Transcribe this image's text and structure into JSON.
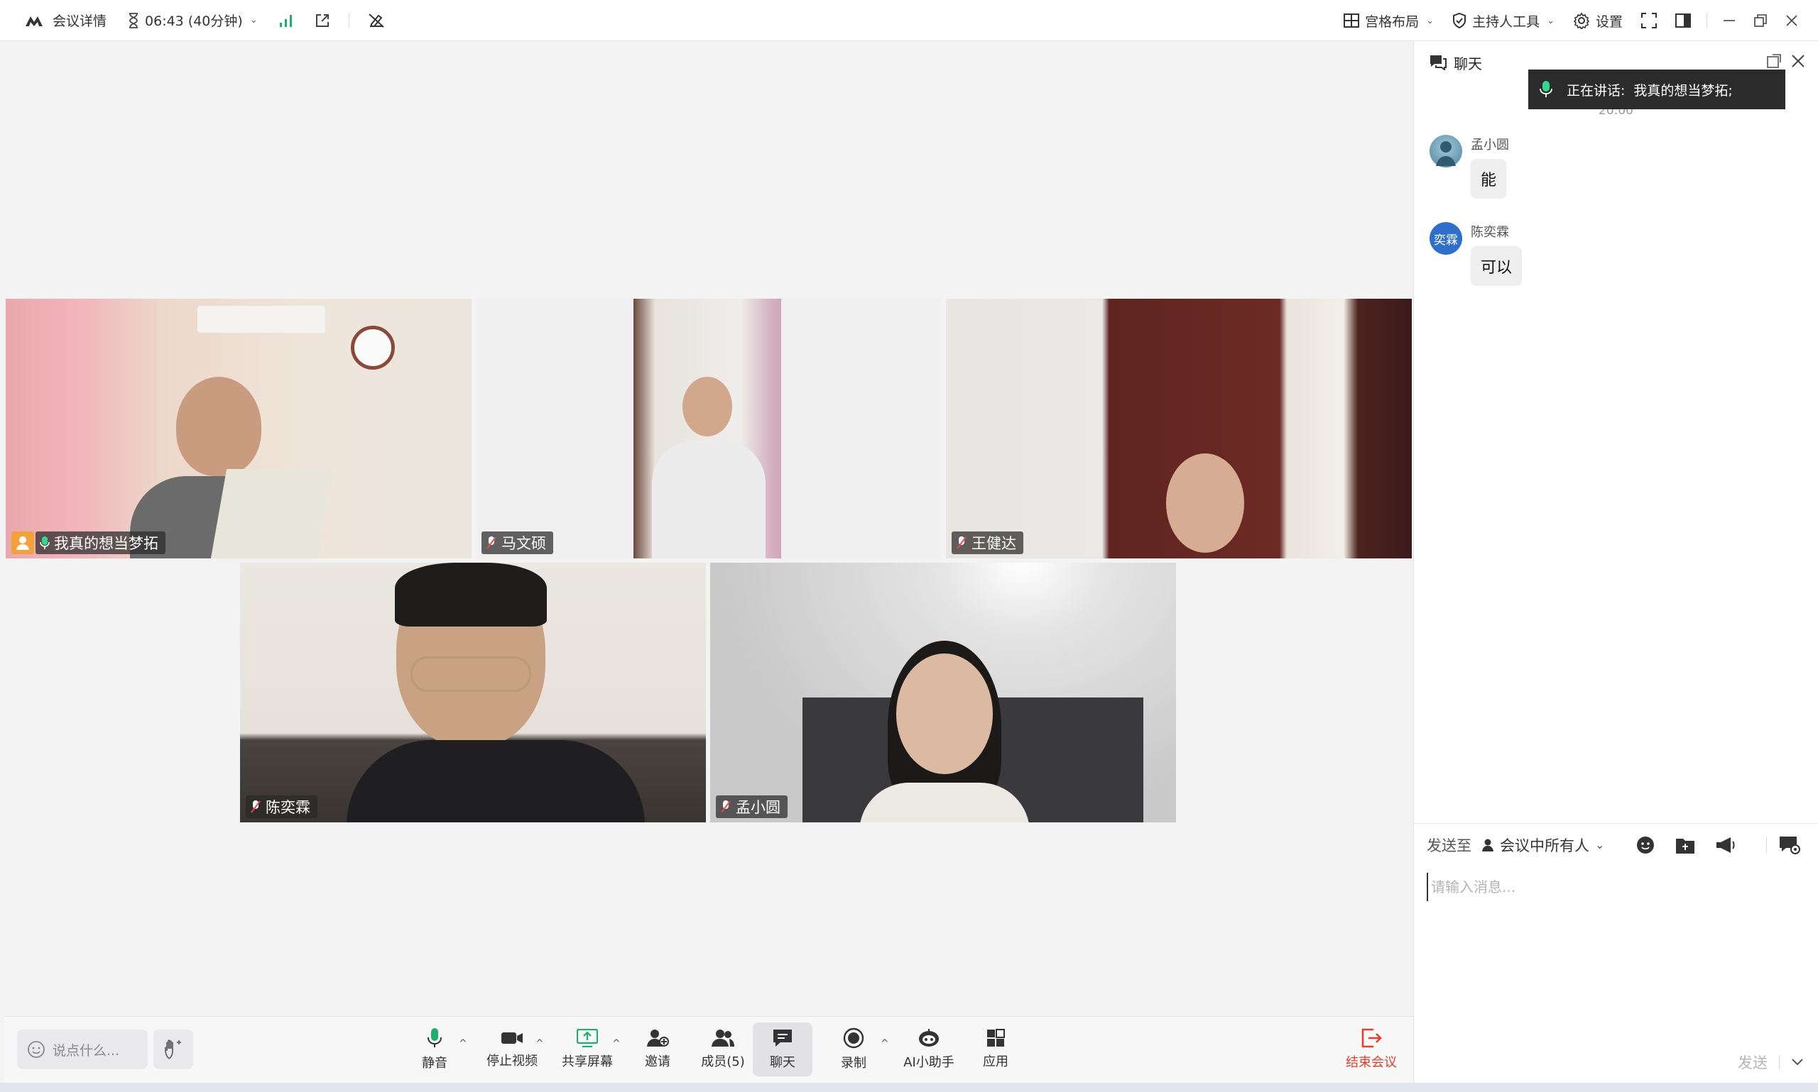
{
  "topbar": {
    "meeting_details": "会议详情",
    "timer": "06:43 (40分钟)",
    "layout": "宫格布局",
    "host_tools": "主持人工具",
    "settings": "设置"
  },
  "participants": [
    {
      "name": "我真的想当梦拓",
      "speaking": true,
      "host": true
    },
    {
      "name": "马文硕"
    },
    {
      "name": "王健达"
    },
    {
      "name": "陈奕霖"
    },
    {
      "name": "孟小圆"
    }
  ],
  "toolbar": {
    "say_placeholder": "说点什么...",
    "mute": "静音",
    "stop_video": "停止视频",
    "share_screen": "共享屏幕",
    "invite": "邀请",
    "members": "成员(5)",
    "chat": "聊天",
    "record": "录制",
    "ai_assistant": "AI小助手",
    "apps": "应用",
    "end_meeting": "结束会议"
  },
  "chat": {
    "title": "聊天",
    "speaking_label": "正在讲话:",
    "speaking_name": "我真的想当梦拓;",
    "time": "20:00",
    "messages": [
      {
        "sender": "孟小圆",
        "text": "能",
        "avatar_text": ""
      },
      {
        "sender": "陈奕霖",
        "text": "可以",
        "avatar_text": "奕霖"
      }
    ],
    "send_to_label": "发送至",
    "send_to_target": "会议中所有人",
    "input_placeholder": "请输入消息...",
    "send": "发送"
  },
  "colors": {
    "speaking_border": "#2fc28b",
    "end_meeting": "#e0412e",
    "host_badge": "#f2a23a",
    "avatar_blue": "#2d6fcb"
  }
}
